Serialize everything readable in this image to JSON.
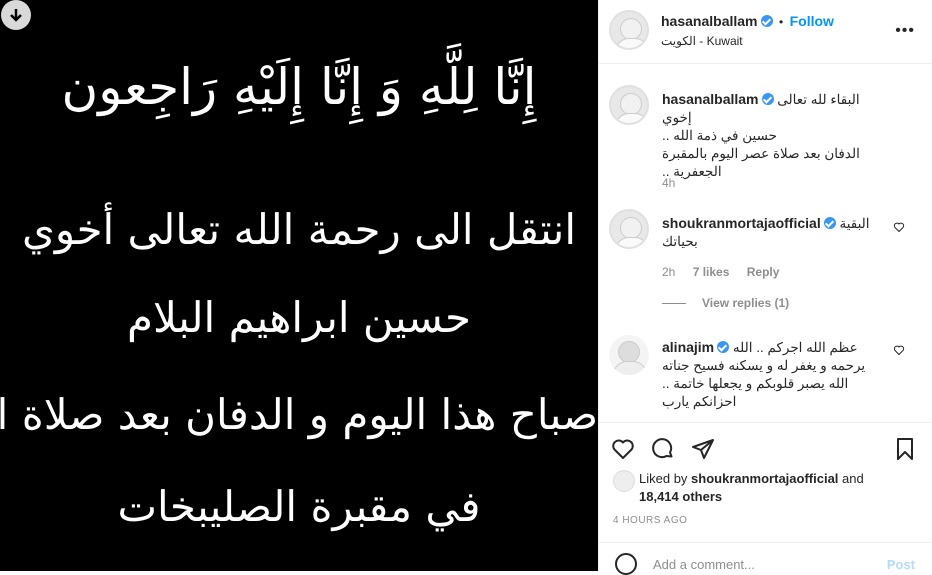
{
  "media": {
    "lines": [
      "إِنَّا لِلَّهِ وَ إِنَّا إِلَيْهِ رَاجِعون",
      "انتقل الى رحمة الله تعالى أخوي",
      "حسين ابراهيم البلام",
      "صباح هذا اليوم و الدفان بعد صلاة العصر",
      "في مقبرة الصليبخات"
    ]
  },
  "post_header": {
    "username": "hasanalballam",
    "follow_label": "Follow",
    "location": "الكويت - Kuwait",
    "more_label": "•••"
  },
  "caption": {
    "username": "hasanalballam",
    "lines": [
      "البقاء لله تعالى إخوي",
      "حسين في ذمة الله ..",
      "الدفان بعد صلاة عصر اليوم بالمقبرة",
      "الجعفرية .."
    ],
    "time": "4h"
  },
  "comments": [
    {
      "username": "shoukranmortajaofficial",
      "lines": [
        "البقية",
        "بحياتك"
      ],
      "time": "2h",
      "likes": "7 likes",
      "reply_label": "Reply"
    },
    {
      "username": "alinajim",
      "lines": [
        "عظم الله اجركم .. الله",
        "يرحمه و يغفر له و يسكنه فسيح جناته",
        "الله يصبر قلوبكم و يجعلها خاتمة ..",
        "احزانكم يارب"
      ]
    }
  ],
  "view_replies": "View replies (1)",
  "likes": {
    "prefix": "Liked by",
    "user": "shoukranmortajaofficial",
    "and": "and",
    "others": "18,414 others"
  },
  "timestamp": "4 HOURS AGO",
  "add_comment": {
    "placeholder": "Add a comment...",
    "post_label": "Post"
  }
}
